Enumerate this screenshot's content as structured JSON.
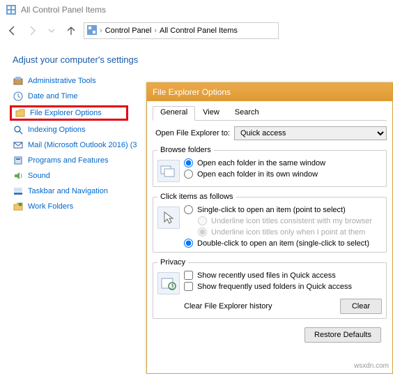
{
  "window": {
    "title": "All Control Panel Items"
  },
  "breadcrumb": {
    "root": "Control Panel",
    "leaf": "All Control Panel Items"
  },
  "heading": "Adjust your computer's settings",
  "sidebar": {
    "items": [
      {
        "label": "Administrative Tools"
      },
      {
        "label": "Date and Time"
      },
      {
        "label": "File Explorer Options"
      },
      {
        "label": "Indexing Options"
      },
      {
        "label": "Mail (Microsoft Outlook 2016) (3"
      },
      {
        "label": "Programs and Features"
      },
      {
        "label": "Sound"
      },
      {
        "label": "Taskbar and Navigation"
      },
      {
        "label": "Work Folders"
      }
    ]
  },
  "dialog": {
    "title": "File Explorer Options",
    "tabs": {
      "general": "General",
      "view": "View",
      "search": "Search"
    },
    "open_to_label": "Open File Explorer to:",
    "open_to_value": "Quick access",
    "browse": {
      "legend": "Browse folders",
      "same": "Open each folder in the same window",
      "own": "Open each folder in its own window"
    },
    "click": {
      "legend": "Click items as follows",
      "single": "Single-click to open an item (point to select)",
      "underline_browser": "Underline icon titles consistent with my browser",
      "underline_point": "Underline icon titles only when I point at them",
      "double": "Double-click to open an item (single-click to select)"
    },
    "privacy": {
      "legend": "Privacy",
      "recent": "Show recently used files in Quick access",
      "frequent": "Show frequently used folders in Quick access",
      "clear_label": "Clear File Explorer history",
      "clear_btn": "Clear"
    },
    "restore_btn": "Restore Defaults"
  },
  "watermark": "wsxdn.com"
}
